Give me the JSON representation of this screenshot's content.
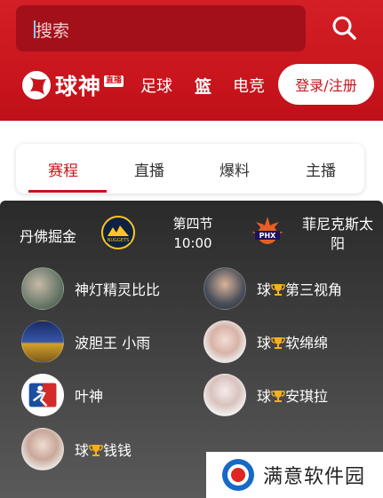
{
  "search": {
    "placeholder": "搜索"
  },
  "brand": {
    "name": "球神",
    "badge": "直播"
  },
  "nav": {
    "items": [
      "足球",
      "篮",
      "电竞"
    ],
    "login_label": "登录/注册"
  },
  "tabs": [
    "赛程",
    "直播",
    "爆料",
    "主播"
  ],
  "match": {
    "home": "丹佛掘金",
    "away": "菲尼克斯太阳",
    "period": "第四节",
    "clock": "10:00"
  },
  "anchors": [
    {
      "prefix": "",
      "name": "神灯精灵比比"
    },
    {
      "prefix": "球",
      "name": "第三视角"
    },
    {
      "prefix": "",
      "name": "波胆王 小雨"
    },
    {
      "prefix": "球",
      "name": "软绵绵"
    },
    {
      "prefix": "",
      "name": "叶神"
    },
    {
      "prefix": "球",
      "name": "安琪拉"
    },
    {
      "prefix": "球",
      "name": "钱钱"
    }
  ],
  "watermark": {
    "text": "满意软件园"
  },
  "colors": {
    "brand_red": "#c8141c",
    "panel_dark": "#2a2a2a"
  }
}
